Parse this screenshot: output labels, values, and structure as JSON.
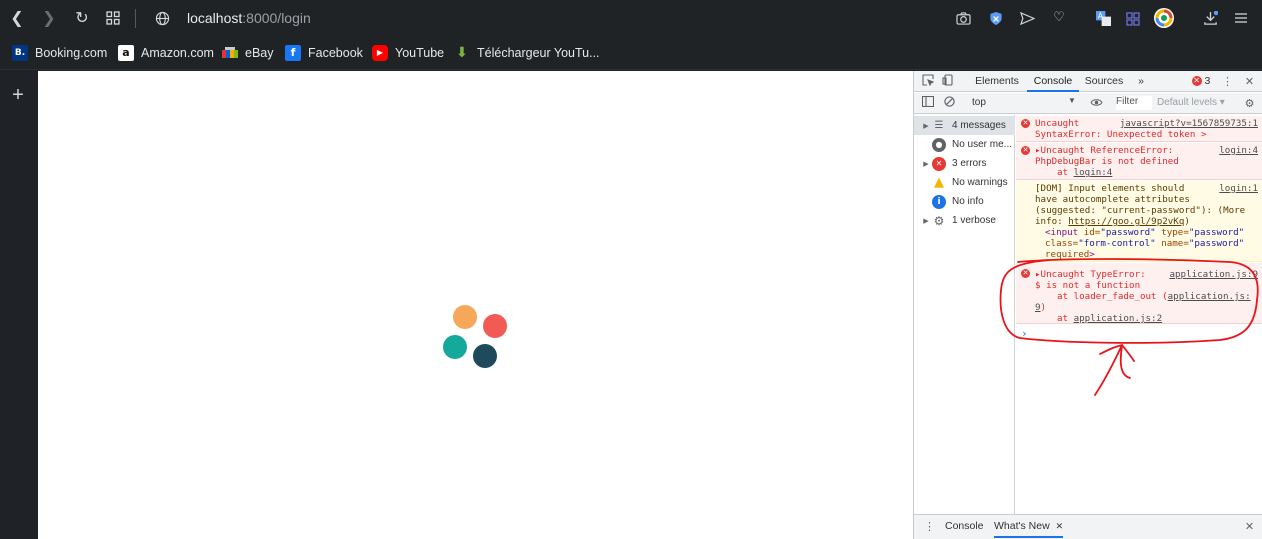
{
  "browser": {
    "url_host": "localhost",
    "url_rest": ":8000/login",
    "bookmarks": [
      {
        "label": "Booking.com",
        "icon": "booking-icon",
        "color": "#003580",
        "glyph": "B."
      },
      {
        "label": "Amazon.com",
        "icon": "amazon-icon",
        "color": "#ffffff",
        "glyph": "a"
      },
      {
        "label": "eBay",
        "icon": "ebay-icon",
        "color": "#e53238",
        "glyph": "e"
      },
      {
        "label": "Facebook",
        "icon": "facebook-icon",
        "color": "#1877f2",
        "glyph": "f"
      },
      {
        "label": "YouTube",
        "icon": "youtube-icon",
        "color": "#ff0000",
        "glyph": "▶"
      },
      {
        "label": "Téléchargeur YouTu...",
        "icon": "download-arrow-icon",
        "color": "#7cb342",
        "glyph": "⬇"
      }
    ]
  },
  "page": {
    "loader_colors": [
      "#f6a75a",
      "#f25a55",
      "#14a99a",
      "#1e4a5b"
    ]
  },
  "devtools": {
    "tabs": {
      "elements": "Elements",
      "console": "Console",
      "sources": "Sources",
      "more": "»"
    },
    "error_count": "3",
    "context": "top",
    "filter_placeholder": "Filter",
    "levels": "Default levels ▾",
    "sidebar": [
      {
        "label": "4 messages",
        "icon": "list-icon"
      },
      {
        "label": "No user me...",
        "icon": "user-icon"
      },
      {
        "label": "3 errors",
        "icon": "error-icon"
      },
      {
        "label": "No warnings",
        "icon": "warning-icon"
      },
      {
        "label": "No info",
        "icon": "info-icon"
      },
      {
        "label": "1 verbose",
        "icon": "gear-icon"
      }
    ],
    "messages": {
      "m1": {
        "line1": "Uncaught",
        "source": "javascript?v=1567859735:1",
        "line2": "SyntaxError: Unexpected token >"
      },
      "m2": {
        "line1": "▸Uncaught ReferenceError:",
        "source": "login:4",
        "line2": "PhpDebugBar is not defined",
        "line3_prefix": "at ",
        "line3_link": "login:4"
      },
      "m3": {
        "line1": "[DOM] Input elements should",
        "source": "login:1",
        "line2": "have autocomplete attributes",
        "line3": "(suggested: \"current-password\"): (More",
        "line4_prefix": "info: ",
        "line4_link": "https://goo.gl/9p2vKq",
        "line4_suffix": ")",
        "html_tag_open": "<input ",
        "html_id_attr": "id=",
        "html_id_val": "\"password\"",
        "html_type_attr": " type=",
        "html_type_val": "\"password\"",
        "html_class_attr": "class=",
        "html_class_val": "\"form-control\"",
        "html_name_attr": " name=",
        "html_name_val": "\"password\"",
        "html_required": "required",
        "html_close": ">"
      },
      "m4": {
        "line1": "▸Uncaught TypeError:",
        "source": "application.js:9",
        "line2": "$ is not a function",
        "line3_prefix": "at loader_fade_out (",
        "line3_link": "application.js:",
        "line4_link": "9",
        "line4_suffix": ")",
        "line5_prefix": "at ",
        "line5_link": "application.js:2"
      }
    },
    "drawer": {
      "console": "Console",
      "whats_new": "What's New",
      "close": "✕"
    }
  }
}
